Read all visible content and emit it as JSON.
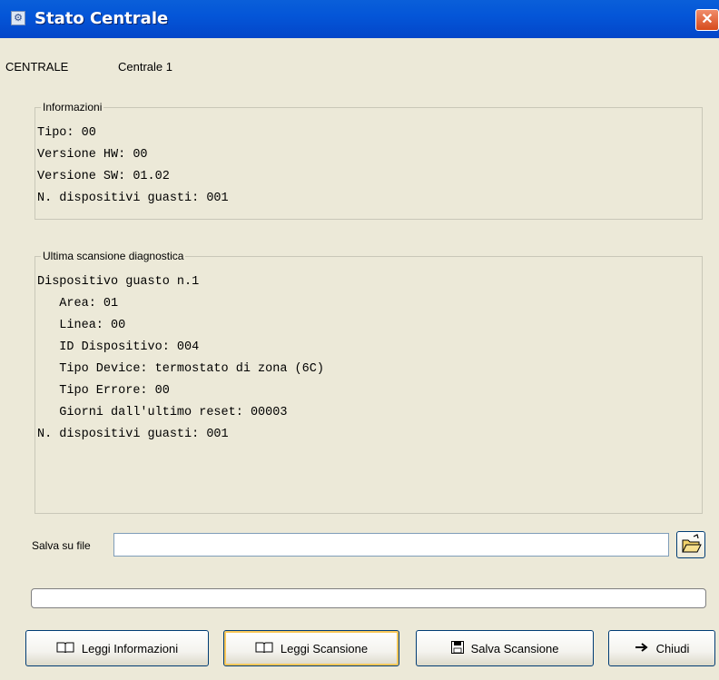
{
  "window": {
    "title": "Stato Centrale"
  },
  "central": {
    "label": "CENTRALE",
    "name": "Centrale 1"
  },
  "info": {
    "legend": "Informazioni",
    "lines": [
      "Tipo: 00",
      "Versione HW: 00",
      "Versione SW: 01.02",
      "N. dispositivi guasti: 001"
    ]
  },
  "scan": {
    "legend": "Ultima scansione diagnostica",
    "lines": [
      "Dispositivo guasto n.1",
      "   Area: 01",
      "   Linea: 00",
      "   ID Dispositivo: 004",
      "   Tipo Device: termostato di zona (6C)",
      "   Tipo Errore: 00",
      "   Giorni dall'ultimo reset: 00003",
      "N. dispositivi guasti: 001"
    ]
  },
  "save": {
    "label": "Salva su file",
    "value": ""
  },
  "progress": {
    "value": 0
  },
  "buttons": {
    "read_info": "Leggi Informazioni",
    "read_scan": "Leggi Scansione",
    "save_scan": "Salva Scansione",
    "close": "Chiudi"
  },
  "icons": {
    "window": "app-icon",
    "close": "close-icon",
    "browse": "open-folder-icon",
    "read_info": "book-icon",
    "read_scan": "book-icon",
    "save_scan": "floppy-disk-icon",
    "close_btn": "arrow-right-icon"
  },
  "colors": {
    "titlebar": "#0456d8",
    "background": "#ece9d8",
    "button_border": "#003c74",
    "focus": "#f9c85a"
  }
}
